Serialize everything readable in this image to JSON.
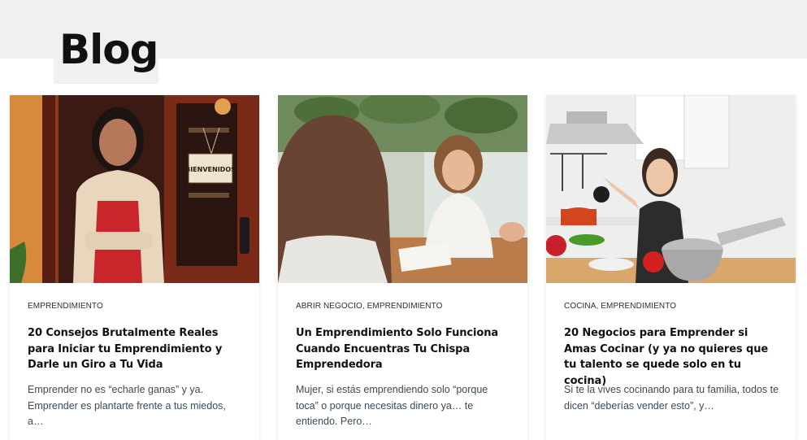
{
  "page": {
    "heading": "Blog"
  },
  "posts": [
    {
      "categories": "EMPRENDIMIENTO",
      "title": "20 Consejos Brutalmente Reales para Iniciar tu Emprendimiento y Darle un Giro a Tu Vida",
      "excerpt": "Emprender no es “echarle ganas” y ya. Emprender es plantarte frente a tus miedos, a…",
      "image_sign": "BIENVENIDOS"
    },
    {
      "categories": "ABRIR NEGOCIO, EMPRENDIMIENTO",
      "title": "Un Emprendimiento Solo Funciona Cuando Encuentras Tu Chispa Emprendedora",
      "excerpt": "Mujer, si estás emprendiendo solo “porque toca” o porque necesitas dinero ya… te entiendo. Pero…"
    },
    {
      "categories": "COCINA, EMPRENDIMIENTO",
      "title": "20 Negocios para Emprender si Amas Cocinar (y ya no quieres que tu talento se quede solo en tu cocina)",
      "excerpt": "Si te la vives cocinando para tu familia, todos te dicen “deberías vender esto”, y…"
    }
  ]
}
